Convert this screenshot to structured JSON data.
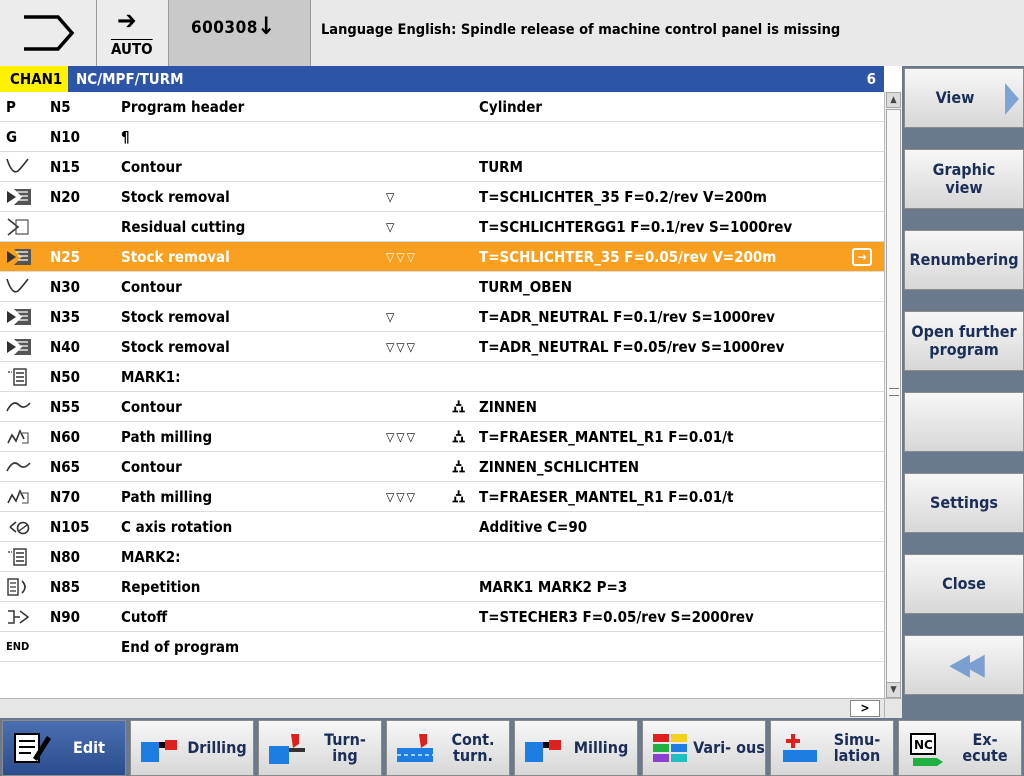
{
  "header": {
    "mode_icon": "jog-mode-icon",
    "auto_label": "AUTO",
    "auto_arrow": "➔",
    "program_number": "600308",
    "program_arrow": "↓",
    "alarm": "Language English: Spindle release of machine control panel is missing"
  },
  "editor": {
    "channel": "CHAN1",
    "path": "NC/MPF/TURM",
    "channel_number": "6",
    "rows": [
      {
        "icon": "program-header-icon",
        "glyph": "P",
        "n": "N5",
        "name": "Program header",
        "tri": "",
        "fix": "",
        "params": "Cylinder",
        "selected": false
      },
      {
        "icon": "gcode-icon",
        "glyph": "G",
        "n": "N10",
        "name": "¶",
        "tri": "",
        "fix": "",
        "params": "",
        "selected": false
      },
      {
        "icon": "contour-icon",
        "glyph": "",
        "n": "N15",
        "name": "Contour",
        "tri": "",
        "fix": "",
        "params": "TURM",
        "selected": false
      },
      {
        "icon": "stock-removal-icon",
        "glyph": "",
        "n": "N20",
        "name": "Stock removal",
        "tri": "▽",
        "fix": "",
        "params": "T=SCHLICHTER_35 F=0.2/rev V=200m",
        "selected": false
      },
      {
        "icon": "residual-cutting-icon",
        "glyph": "",
        "n": "",
        "name": "Residual cutting",
        "tri": "▽",
        "fix": "",
        "params": "T=SCHLICHTERGG1 F=0.1/rev S=1000rev",
        "selected": false
      },
      {
        "icon": "stock-removal-icon",
        "glyph": "",
        "n": "N25",
        "name": "Stock removal",
        "tri": "▽▽▽",
        "fix": "",
        "params": "T=SCHLICHTER_35 F=0.05/rev V=200m",
        "selected": true
      },
      {
        "icon": "contour-icon",
        "glyph": "",
        "n": "N30",
        "name": "Contour",
        "tri": "",
        "fix": "",
        "params": "TURM_OBEN",
        "selected": false
      },
      {
        "icon": "stock-removal-icon",
        "glyph": "",
        "n": "N35",
        "name": "Stock removal",
        "tri": "▽",
        "fix": "",
        "params": "T=ADR_NEUTRAL F=0.1/rev S=1000rev",
        "selected": false
      },
      {
        "icon": "stock-removal-icon",
        "glyph": "",
        "n": "N40",
        "name": "Stock removal",
        "tri": "▽▽▽",
        "fix": "",
        "params": "T=ADR_NEUTRAL F=0.05/rev S=1000rev",
        "selected": false
      },
      {
        "icon": "mark-icon",
        "glyph": "",
        "n": "N50",
        "name": "MARK1:",
        "tri": "",
        "fix": "",
        "params": "",
        "selected": false
      },
      {
        "icon": "milling-contour-icon",
        "glyph": "",
        "n": "N55",
        "name": "Contour",
        "tri": "",
        "fix": "⛼",
        "params": "ZINNEN",
        "selected": false
      },
      {
        "icon": "path-milling-icon",
        "glyph": "",
        "n": "N60",
        "name": "Path milling",
        "tri": "▽▽▽",
        "fix": "⛼",
        "params": "T=FRAESER_MANTEL_R1 F=0.01/t",
        "selected": false
      },
      {
        "icon": "milling-contour-icon",
        "glyph": "",
        "n": "N65",
        "name": "Contour",
        "tri": "",
        "fix": "⛼",
        "params": "ZINNEN_SCHLICHTEN",
        "selected": false
      },
      {
        "icon": "path-milling-icon",
        "glyph": "",
        "n": "N70",
        "name": "Path milling",
        "tri": "▽▽▽",
        "fix": "⛼",
        "params": "T=FRAESER_MANTEL_R1 F=0.01/t",
        "selected": false
      },
      {
        "icon": "c-axis-rotation-icon",
        "glyph": "",
        "n": "N105",
        "name": "C axis rotation",
        "tri": "",
        "fix": "",
        "params": "Additive C=90",
        "selected": false
      },
      {
        "icon": "mark-icon",
        "glyph": "",
        "n": "N80",
        "name": "MARK2:",
        "tri": "",
        "fix": "",
        "params": "",
        "selected": false
      },
      {
        "icon": "repetition-icon",
        "glyph": "",
        "n": "N85",
        "name": "Repetition",
        "tri": "",
        "fix": "",
        "params": "MARK1 MARK2 P=3",
        "selected": false
      },
      {
        "icon": "cutoff-icon",
        "glyph": "",
        "n": "N90",
        "name": "Cutoff",
        "tri": "",
        "fix": "",
        "params": "T=STECHER3 F=0.05/rev S=2000rev",
        "selected": false
      },
      {
        "icon": "end-icon",
        "glyph": "END",
        "n": "",
        "name": "End of program",
        "tri": "",
        "fix": "",
        "params": "",
        "selected": false
      }
    ],
    "hscroll_arrow": ">"
  },
  "right_keys": [
    {
      "name": "view-button",
      "label": "View"
    },
    {
      "name": "graphic-view-button",
      "label": "Graphic view"
    },
    {
      "name": "renumbering-button",
      "label": "Renumbering"
    },
    {
      "name": "open-further-program-button",
      "label": "Open further program"
    },
    {
      "name": "empty-softkey-5",
      "label": ""
    },
    {
      "name": "settings-button",
      "label": "Settings"
    },
    {
      "name": "close-button",
      "label": "Close"
    },
    {
      "name": "back-button",
      "label": "◀◀"
    }
  ],
  "bottom_keys": [
    {
      "name": "edit-button",
      "label": "Edit",
      "icon": "edit-icon",
      "active": true
    },
    {
      "name": "drilling-button",
      "label": "Drilling",
      "icon": "drilling-icon",
      "active": false
    },
    {
      "name": "turning-button",
      "label": "Turn- ing",
      "icon": "turning-icon",
      "active": false
    },
    {
      "name": "contour-turning-button",
      "label": "Cont. turn.",
      "icon": "contour-turning-icon",
      "active": false
    },
    {
      "name": "milling-button",
      "label": "Milling",
      "icon": "milling-icon",
      "active": false
    },
    {
      "name": "various-button",
      "label": "Vari- ous",
      "icon": "various-icon",
      "active": false
    },
    {
      "name": "simulation-button",
      "label": "Simu- lation",
      "icon": "simulation-icon",
      "active": false
    },
    {
      "name": "execute-button",
      "label": "Ex- ecute",
      "icon": "nc-execute-icon",
      "active": false
    }
  ],
  "colors": {
    "title_bar": "#2c55a6",
    "channel_highlight": "#fff100",
    "selected_row": "#f9a020",
    "softkey_text": "#1a2e57",
    "active_softkey": "#2b4d8e"
  }
}
